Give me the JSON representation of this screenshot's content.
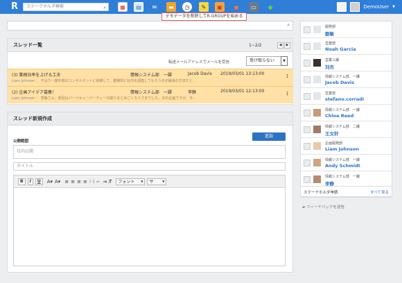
{
  "topbar": {
    "logo": "R",
    "search_placeholder": "ステークホルダ検索",
    "user_name": "DemoUser",
    "notice": "デモデータを削除してR-GROUPを始める"
  },
  "threads": {
    "title": "スレッド一覧",
    "pager": "1~2/2",
    "mail_hint": "転送メールアドレスでメールを受信",
    "mail_select": "受け取らない",
    "items": [
      {
        "title": "(3) 業務効率を上げる工夫",
        "dept": "情報システム部　一課",
        "user": "Jacob Davis",
        "date": "2019/03/01 13:13:00",
        "author": "Liam Johnson",
        "body": "やはり一度外部のコンサルタントに依頼して、業務的に社内を調査してもらうのが最良の方法だと…"
      },
      {
        "title": "(2) 企画アイデア募集！",
        "dept": "情報システム部　一課",
        "user": "李静",
        "date": "2019/03/01 12:13:00",
        "author": "Liam Johnson",
        "body": "李静さん、前回はバーベキューパーティーの取りまとめごくろうさまでした。次の企画ですが、今…"
      }
    ]
  },
  "new_thread": {
    "title": "スレッド新規作成",
    "add_button": "追加",
    "scope_label": "公開範囲",
    "scope_value": "社内公開",
    "title_placeholder": "タイトル",
    "font_select": "フォント",
    "size_select": "サ"
  },
  "sidebar": {
    "people": [
      {
        "dept": "開発部",
        "name": "劉敏"
      },
      {
        "dept": "営業部",
        "name": "Noah Garcia"
      },
      {
        "dept": "営業三課",
        "name": "刘杰"
      },
      {
        "dept": "情報システム部　一課",
        "name": "Jacob Davis"
      },
      {
        "dept": "営業部",
        "name": "stefano.corradi"
      },
      {
        "dept": "情報システム部　一課",
        "name": "Chloe Reed"
      },
      {
        "dept": "情報システム部　二課",
        "name": "王文轩"
      },
      {
        "dept": "企画開発部",
        "name": "Liam Johnson"
      },
      {
        "dept": "情報システム部　一課",
        "name": "Andy Schmidt"
      },
      {
        "dept": "情報システム部　一課",
        "name": "李静"
      }
    ],
    "search_placeholder": "検索",
    "stakeholder_request": "ステークホルダ申請",
    "see_all": "すべて見る",
    "feedback": "フィードバックを送信"
  }
}
